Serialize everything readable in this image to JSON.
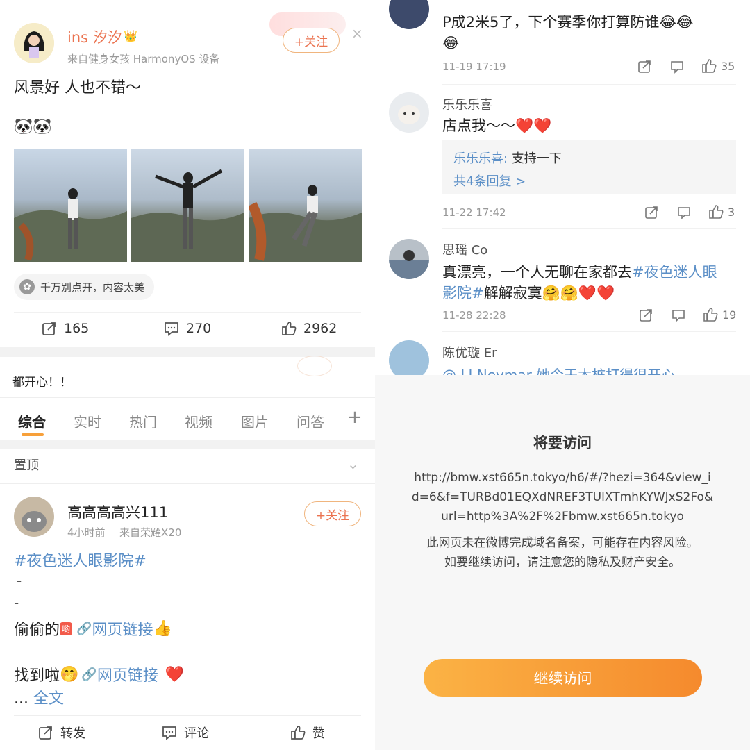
{
  "post1": {
    "username": "ins 汐汐",
    "source": "来自健身女孩 HarmonyOS 设备",
    "follow": "+关注",
    "text": "风景好 人也不错～",
    "emoji": "🐼🐼",
    "collapse_tag": "千万别点开，内容太美",
    "repost_count": "165",
    "comment_count": "270",
    "like_count": "2962"
  },
  "comments": {
    "c0": {
      "text": "P成2米5了，下个赛季你打算防谁😂😂",
      "text2": "😂",
      "time": "11-19 17:19",
      "likes": "35"
    },
    "c1": {
      "name": "乐乐乐喜",
      "text": "店点我～～",
      "reply_name": "乐乐乐喜:",
      "reply_text": "支持一下",
      "reply_more": "共4条回复 >",
      "time": "11-22 17:42",
      "likes": "3"
    },
    "c2": {
      "name": "思瑶 Co",
      "text_a": "真漂亮，一个人无聊在家都去",
      "hashtag_a": "#夜色迷人眼",
      "hashtag_b": "影院#",
      "text_b": "解解寂寞",
      "emoji": "🤗🤗",
      "time": "11-28 22:28",
      "likes": "19"
    },
    "c3": {
      "name": "陈优璇 Er",
      "text": "@ LI Neymar 她今天木桩打得很开心"
    }
  },
  "snippet_text": "都开心！！",
  "tabs": [
    "综合",
    "实时",
    "热门",
    "视频",
    "图片",
    "问答"
  ],
  "tab_plus": "+",
  "pinned_label": "置顶",
  "post2": {
    "username": "高高高高兴111",
    "time": "4小时前",
    "source": "来自荣耀X20",
    "follow": "+关注",
    "hashtag": "#夜色迷人眼影院#",
    "dash1": "-",
    "dash2": "-",
    "line1_text": "偷偷的",
    "line1_emoji_end": "👍",
    "weblink": "网页链接",
    "line2_text": "找到啦",
    "line2_emoji": "🤭",
    "more_prefix": "...",
    "more_label": "全文",
    "repost_label": "转发",
    "comment_label": "评论",
    "like_label": "赞"
  },
  "dialog": {
    "title": "将要访问",
    "url_line1": "http://bmw.xst665n.tokyo/h6/#/?hezi=364&view_i",
    "url_line2": "d=6&f=TURBd01EQXdNREF3TUlXTmhKYWJxS2Fo&",
    "url_line3": "url=http%3A%2F%2Fbmw.xst665n.tokyo",
    "warning_line1": "此网页未在微博完成域名备案，可能存在内容风险。",
    "warning_line2": "如要继续访问，请注意您的隐私及财产安全。",
    "continue_label": "继续访问"
  },
  "colors": {
    "accent": "#eb7350",
    "link": "#5b8fc7",
    "button_start": "#fbb345",
    "button_end": "#f58a2d"
  }
}
